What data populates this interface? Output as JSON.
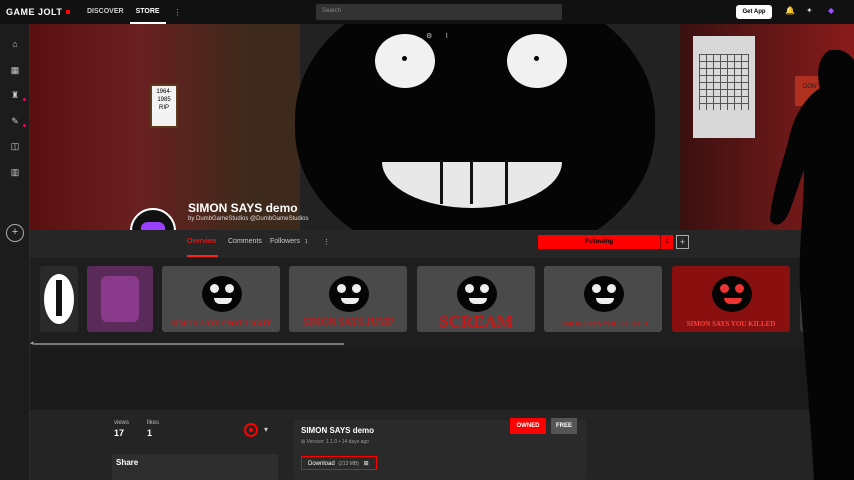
{
  "topbar": {
    "logo": "GAME JOLT",
    "nav": [
      "DISCOVER",
      "STORE"
    ],
    "search_placeholder": "Search",
    "get_app": "Get App"
  },
  "banner": {
    "rip_text": "1964-1985 RIP",
    "door_text": "DON'T"
  },
  "game": {
    "title": "SIMON SAYS demo",
    "by": "by DumbGameStudios @DumbGameStudios"
  },
  "tabs": {
    "overview": "Overview",
    "comments": "Comments",
    "followers": "Followers",
    "followers_count": "1",
    "following": "Following",
    "follow_count": "1"
  },
  "thumbs": [
    {
      "caption": ""
    },
    {
      "caption": ""
    },
    {
      "caption": "SIMON SAYS SPOT LIGHT"
    },
    {
      "caption": "SIMON SAYS JUMP"
    },
    {
      "caption": "SCREAM"
    },
    {
      "caption": "SIMON SAYS YOU KILLED"
    },
    {
      "caption": "SIMON SAYS YOU KILLED"
    }
  ],
  "stats": {
    "views_label": "views",
    "views": "17",
    "likes_label": "likes",
    "likes": "1"
  },
  "share": {
    "title": "Share"
  },
  "package": {
    "title": "SIMON SAYS demo",
    "version": "Version: 1.1.0",
    "age": "14 days ago",
    "owned": "OWNED",
    "free": "FREE",
    "download": "Download",
    "size": "(213 MB)"
  },
  "colors": {
    "accent": "#ff0000",
    "background": "#1a1a1a",
    "purple": "#9b40ff"
  }
}
